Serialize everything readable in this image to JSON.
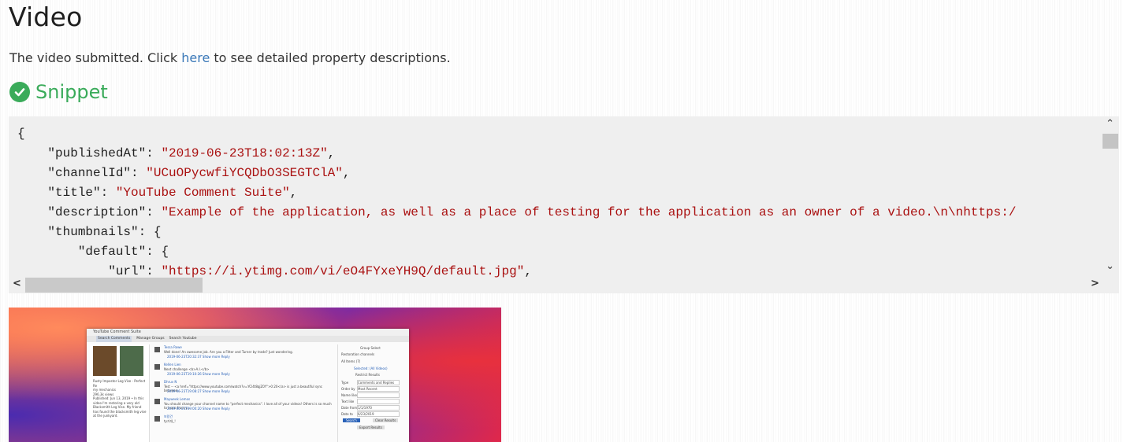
{
  "heading": "Video",
  "intro": {
    "before": "The video submitted. Click ",
    "link": "here",
    "after": " to see detailed property descriptions."
  },
  "snippet": {
    "label": "Snippet",
    "icon": "check-circle-icon"
  },
  "code": {
    "open": "{",
    "lines": [
      {
        "indent": "    ",
        "key": "\"publishedAt\"",
        "sep": ": ",
        "value": "\"2019-06-23T18:02:13Z\"",
        "end": ","
      },
      {
        "indent": "    ",
        "key": "\"channelId\"",
        "sep": ": ",
        "value": "\"UCuOPycwfiYCQDbO3SEGTClA\"",
        "end": ","
      },
      {
        "indent": "    ",
        "key": "\"title\"",
        "sep": ": ",
        "value": "\"YouTube Comment Suite\"",
        "end": ","
      },
      {
        "indent": "    ",
        "key": "\"description\"",
        "sep": ": ",
        "value": "\"Example of the application, as well as a place of testing for the application as an owner of a video.\\n\\nhttps:/",
        "end": ""
      },
      {
        "indent": "    ",
        "key": "\"thumbnails\"",
        "sep": ": ",
        "value": "",
        "end": "{"
      },
      {
        "indent": "        ",
        "key": "\"default\"",
        "sep": ": ",
        "value": "",
        "end": "{"
      },
      {
        "indent": "            ",
        "key": "\"url\"",
        "sep": ": ",
        "value": "\"https://i.ytimg.com/vi/eO4FYxeYH9Q/default.jpg\"",
        "end": ","
      }
    ]
  },
  "scroll": {
    "up": "⌃",
    "down": "⌄",
    "left": "<",
    "right": ">"
  },
  "thumbnail": {
    "window_title": "YouTube Comment Suite",
    "tabs": [
      "Search Comments",
      "Manage Groups",
      "Search Youtube"
    ],
    "video_title": "Rusty Impostor Leg Vise - Perfect Re",
    "channel": "my mechanics",
    "views": "296.3k views",
    "description": "Published: Jun 13, 2019 • In this video I'm restoring a very old Blacksmith Leg Vise. My friend has found the blacksmith leg vise at the junkyard.",
    "comments": [
      {
        "name": "Tessa Rowe",
        "text": "Well done! An awesome job. Are you a Fitter and Turner by trade? Just wondering.",
        "meta": "2019-06-23T20:32:37   Show more   Reply"
      },
      {
        "name": "Kellen Lien",
        "text": "Next challenge <b>A.I.</b>",
        "meta": "2019-06-23T19:10:26   Show more   Reply"
      },
      {
        "name": "Dhruv N",
        "text": "Test -- <a href=\"https://www.youtube.com/watch?v=YCl4t8qjZ0Y\">0:20</a> is just a beautiful sync between...",
        "meta": "2019-06-23T19:08:27   Show more   Reply"
      },
      {
        "name": "Mayweek Lemos",
        "text": "You should change your channel name to \"perfect mechanics\". I love all of your videos! Others is so much to learn from y...",
        "meta": "2019-06-23T09:00:20   Show more   Reply"
      },
      {
        "name": "보람건",
        "text": "ty거대_!",
        "meta": ""
      }
    ],
    "group_select": {
      "title": "Group Select",
      "group": "Restoration channels",
      "items": "All Items (7)",
      "selected": "Selected: (All Videos)",
      "restrict": "Restrict Results",
      "type_label": "Type",
      "type_value": "Comments and Replies",
      "order_label": "Order by",
      "order_value": "Most Recent",
      "name_label": "Name like",
      "text_label": "Text like",
      "from_label": "Date from",
      "from_value": "1/1/1970",
      "to_label": "Date to",
      "to_value": "6/23/2019",
      "search_btn": "Search",
      "clear_btn": "Clear Results",
      "export_btn": "Export Results"
    }
  }
}
